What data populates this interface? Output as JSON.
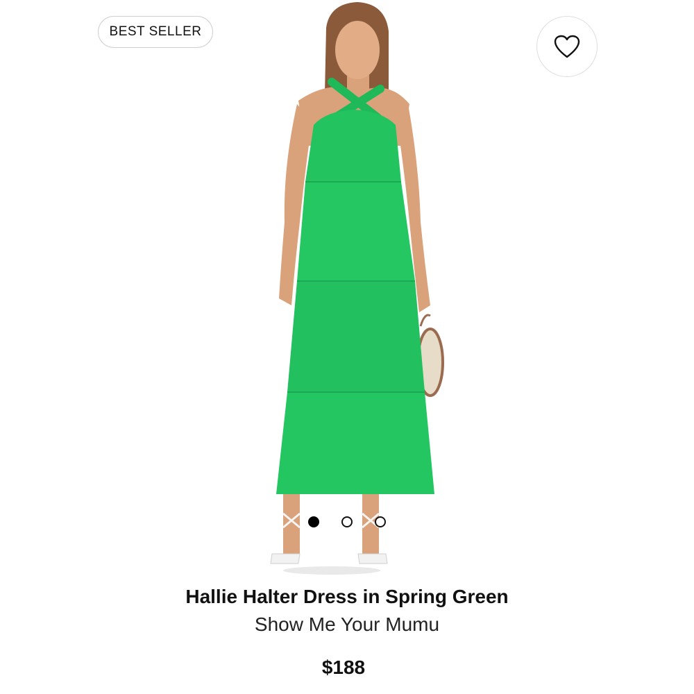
{
  "badge": {
    "label": "BEST SELLER"
  },
  "wishlist": {
    "icon": "heart-icon"
  },
  "product": {
    "title": "Hallie Halter Dress in Spring Green",
    "brand": "Show Me Your Mumu",
    "price": "$188"
  },
  "carousel": {
    "count": 3,
    "active_index": 0
  },
  "colors": {
    "dress": "#22c55e",
    "skin": "#d9a27a",
    "background": "#ffffff",
    "text": "#111111"
  }
}
